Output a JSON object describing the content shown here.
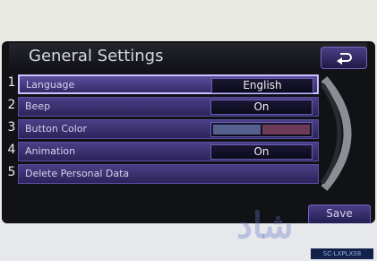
{
  "header": {
    "title": "General Settings",
    "back_icon": "return-icon"
  },
  "rows": [
    {
      "number": "1",
      "label": "Language",
      "value": "English"
    },
    {
      "number": "2",
      "label": "Beep",
      "value": "On"
    },
    {
      "number": "3",
      "label": "Button Color",
      "value": ""
    },
    {
      "number": "4",
      "label": "Animation",
      "value": "On"
    },
    {
      "number": "5",
      "label": "Delete Personal Data",
      "value": ""
    }
  ],
  "button_color_swatches": [
    "#56608f",
    "#6d3a55"
  ],
  "footer": {
    "save_label": "Save"
  },
  "watermark_text": "شاد",
  "image_code": "SC-LXPLX08",
  "colors": {
    "row_purple": "#4a3f86",
    "selected_border": "#c8c0ff",
    "screen_background": "#111216"
  }
}
